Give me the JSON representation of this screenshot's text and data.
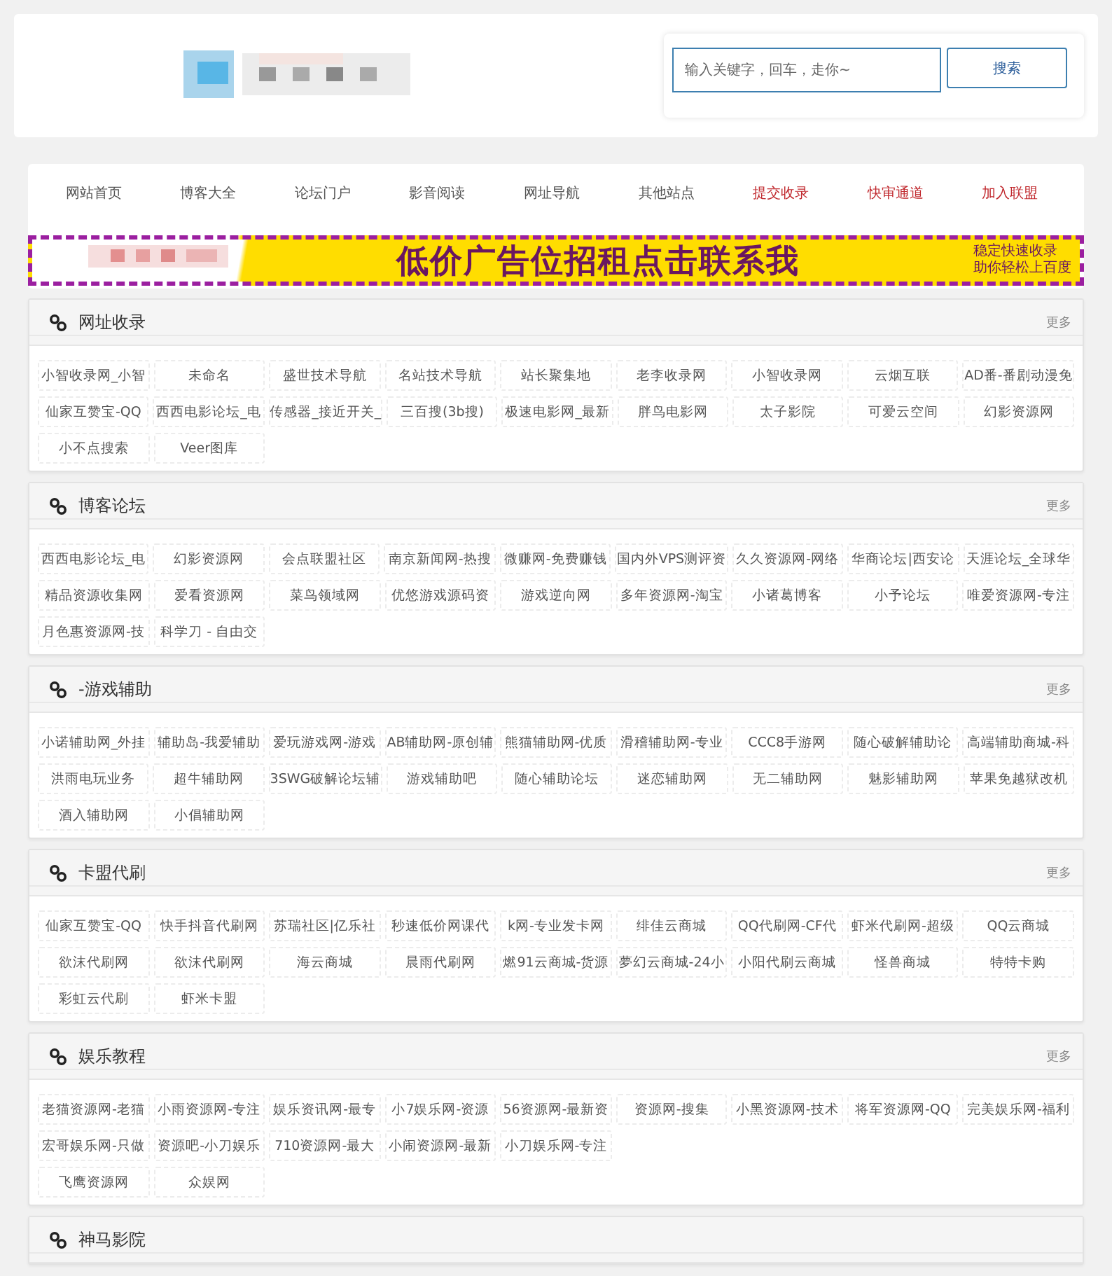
{
  "search": {
    "placeholder": "输入关键字，回车，走你~",
    "button": "搜索"
  },
  "nav": [
    {
      "label": "网站首页",
      "color": "#555555"
    },
    {
      "label": "博客大全",
      "color": "#555555"
    },
    {
      "label": "论坛门户",
      "color": "#555555"
    },
    {
      "label": "影音阅读",
      "color": "#555555"
    },
    {
      "label": "网址导航",
      "color": "#555555"
    },
    {
      "label": "其他站点",
      "color": "#555555"
    },
    {
      "label": "提交收录",
      "color": "#c0282d"
    },
    {
      "label": "快审通道",
      "color": "#c0282d"
    },
    {
      "label": "加入联盟",
      "color": "#c0282d"
    }
  ],
  "banner": {
    "headline": "低价广告位招租点击联系我",
    "tagline_1": "稳定快速收录",
    "tagline_2": "助你轻松上百度"
  },
  "sections": [
    {
      "title": "网址收录",
      "more": "更多",
      "rows": [
        [
          "小智收录网_小智",
          "未命名",
          "盛世技术导航",
          "名站技术导航",
          "站长聚集地",
          "老李收录网",
          "小智收录网",
          "云烟互联",
          "AD番-番剧动漫免"
        ],
        [
          "仙家互赞宝-QQ",
          "西西电影论坛_电",
          "传感器_接近开关_",
          "三百搜(3b搜)",
          "极速电影网_最新",
          "胖鸟电影网",
          "太子影院",
          "可爱云空间",
          "幻影资源网"
        ],
        [
          "小不点搜索",
          "Veer图库"
        ]
      ]
    },
    {
      "title": "博客论坛",
      "more": "更多",
      "rows": [
        [
          "西西电影论坛_电",
          "幻影资源网",
          "会点联盟社区",
          "南京新闻网-热搜",
          "微赚网-免费赚钱",
          "国内外VPS测评资",
          "久久资源网-网络",
          "华商论坛|西安论",
          "天涯论坛_全球华"
        ],
        [
          "精品资源收集网",
          "爱看资源网",
          "菜鸟领域网",
          "优悠游戏源码资",
          "游戏逆向网",
          "多年资源网-淘宝",
          "小诸葛博客",
          "小予论坛",
          "唯爱资源网-专注"
        ],
        [
          "月色惠资源网-技",
          "科学刀 - 自由交"
        ]
      ]
    },
    {
      "title": "-游戏辅助",
      "more": "更多",
      "rows": [
        [
          "小诺辅助网_外挂",
          "辅助岛-我爱辅助",
          "爱玩游戏网-游戏",
          "AB辅助网-原创辅",
          "熊猫辅助网-优质",
          "滑稽辅助网-专业",
          "CCC8手游网",
          "随心破解辅助论",
          "高端辅助商城-科"
        ],
        [
          "洪雨电玩业务",
          "超牛辅助网",
          "3SWG破解论坛辅",
          "游戏辅助吧",
          "随心辅助论坛",
          "迷恋辅助网",
          "无二辅助网",
          "魅影辅助网",
          "苹果免越狱改机"
        ],
        [
          "酒入辅助网",
          "小倡辅助网"
        ]
      ]
    },
    {
      "title": "卡盟代刷",
      "more": "更多",
      "rows": [
        [
          "仙家互赞宝-QQ",
          "快手抖音代刷网",
          "苏瑞社区|亿乐社",
          "秒速低价网课代",
          "k网-专业发卡网",
          "绯佳云商城",
          "QQ代刷网-CF代",
          "虾米代刷网-超级",
          "QQ云商城"
        ],
        [
          "欲沫代刷网",
          "欲沫代刷网",
          "海云商城",
          "晨雨代刷网",
          "燃91云商城-货源",
          "夢幻云商城-24小",
          "小阳代刷云商城",
          "怪兽商城",
          "特特卡购"
        ],
        [
          "彩虹云代刷",
          "虾米卡盟"
        ]
      ]
    },
    {
      "title": "娱乐教程",
      "more": "更多",
      "rows": [
        [
          "老猫资源网-老猫",
          "小雨资源网-专注",
          "娱乐资讯网-最专",
          "小7娱乐网-资源",
          "56资源网-最新资",
          "资源网-搜集",
          "小黑资源网-技术",
          "将军资源网-QQ",
          "完美娱乐网-福利"
        ],
        [
          "宏哥娱乐网-只做",
          "资源吧-小刀娱乐",
          "710资源网-最大",
          "小闹资源网-最新",
          "小刀娱乐网-专注"
        ],
        [
          "飞鹰资源网",
          "众娱网"
        ]
      ]
    },
    {
      "title": "神马影院"
    }
  ]
}
